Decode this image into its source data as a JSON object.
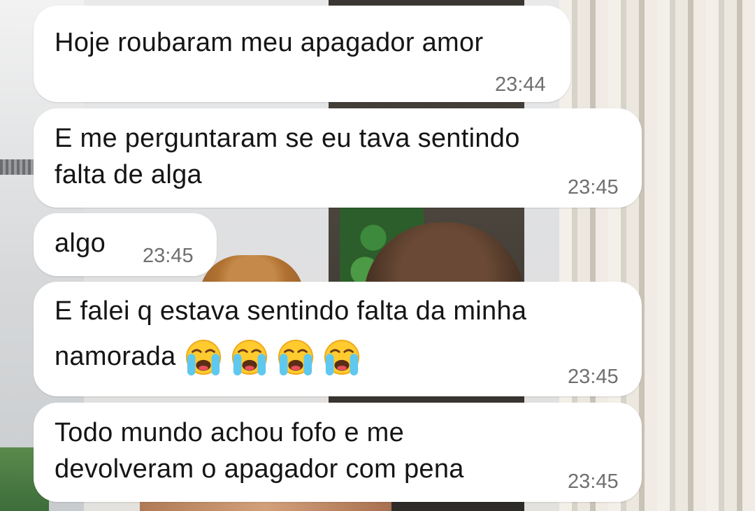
{
  "messages": [
    {
      "lines": [
        "Hoje roubaram meu apagador amor"
      ],
      "time": "23:44"
    },
    {
      "lines": [
        "E me perguntaram se eu tava sentindo",
        "falta de alga"
      ],
      "time": "23:45"
    },
    {
      "lines": [
        "algo"
      ],
      "time": "23:45"
    },
    {
      "lines": [
        "E falei q estava sentindo falta da minha",
        "namorada"
      ],
      "emoji": [
        "loudly-crying-face-icon",
        "loudly-crying-face-icon",
        "loudly-crying-face-icon",
        "loudly-crying-face-icon"
      ],
      "time": "23:45"
    },
    {
      "lines": [
        "Todo mundo achou fofo e me",
        "devolveram o apagador com pena"
      ],
      "time": "23:45"
    }
  ],
  "colors": {
    "bubble": "#ffffff",
    "text": "#151515",
    "timestamp": "#6f6f6f"
  }
}
